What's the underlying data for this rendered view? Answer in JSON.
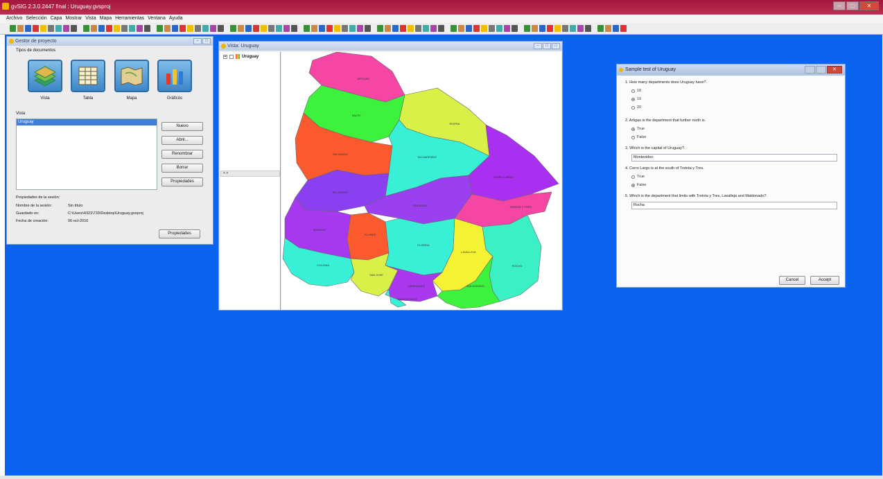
{
  "window": {
    "title": "gvSIG 2.3.0.2447 final : Uruguay.gvsproj"
  },
  "menubar": [
    "Archivo",
    "Selección",
    "Capa",
    "Mostrar",
    "Vista",
    "Mapa",
    "Herramientas",
    "Ventana",
    "Ayuda"
  ],
  "project_manager": {
    "title": "Gestor de proyecto",
    "doc_types_label": "Tipos de documentos",
    "doc_types": [
      {
        "label": "Vista",
        "icon": "layers-icon"
      },
      {
        "label": "Tabla",
        "icon": "table-icon"
      },
      {
        "label": "Mapa",
        "icon": "map-icon"
      },
      {
        "label": "Gráficos",
        "icon": "chart-icon"
      }
    ],
    "list_label": "Vista",
    "list_items": [
      "Uruguay"
    ],
    "buttons": [
      "Nuevo",
      "Abrir...",
      "Renombrar",
      "Borrar",
      "Propiedades"
    ],
    "session": {
      "heading": "Propiedades de la sesión:",
      "name_label": "Nombre de la sesión:",
      "name_value": "Sin título",
      "saved_label": "Guardado en:",
      "saved_value": "C:\\Users\\4321\\733\\Desktop\\Uruguay.gvsproj",
      "date_label": "Fecha de creación:",
      "date_value": "06-oct-2016",
      "properties_button": "Propiedades"
    }
  },
  "view_window": {
    "title": "Vista: Uruguay",
    "layer_name": "Uruguay",
    "scroll_label": "< >",
    "departments": [
      "ARTIGAS",
      "SALTO",
      "RIVERA",
      "PAYSANDU",
      "TACUAREMBO",
      "CERRO LARGO",
      "RIO NEGRO",
      "DURAZNO",
      "TREINTA Y TRES",
      "SORIANO",
      "FLORES",
      "FLORIDA",
      "LAVALLEJA",
      "ROCHA",
      "COLONIA",
      "SAN JOSE",
      "CANELONES",
      "MALDONADO",
      "MONTEVIDEO"
    ]
  },
  "quiz": {
    "title": "Sample test of Uruguay",
    "questions": [
      {
        "text": "1. How many departments does Uruguay have?.",
        "options": [
          "18",
          "19",
          "20"
        ],
        "selected": 1
      },
      {
        "text": "2. Artigas is the department that further north is.",
        "options": [
          "True",
          "False"
        ],
        "selected": 0
      },
      {
        "text": "3. Which is the capital of Uruguay?.",
        "answer": "Montevideo"
      },
      {
        "text": "4. Cerro Largo is at the south of Treinta y Tres.",
        "options": [
          "True",
          "False"
        ],
        "selected": 1
      },
      {
        "text": "5. Which is the department that limits with Treinta y Tres, Lavalleja and Maldonado?.",
        "answer": "Rocha"
      }
    ],
    "cancel": "Cancel",
    "accept": "Accept"
  },
  "colors": {
    "desktop": "#0a64ef",
    "titlebar": "#a4163d"
  }
}
